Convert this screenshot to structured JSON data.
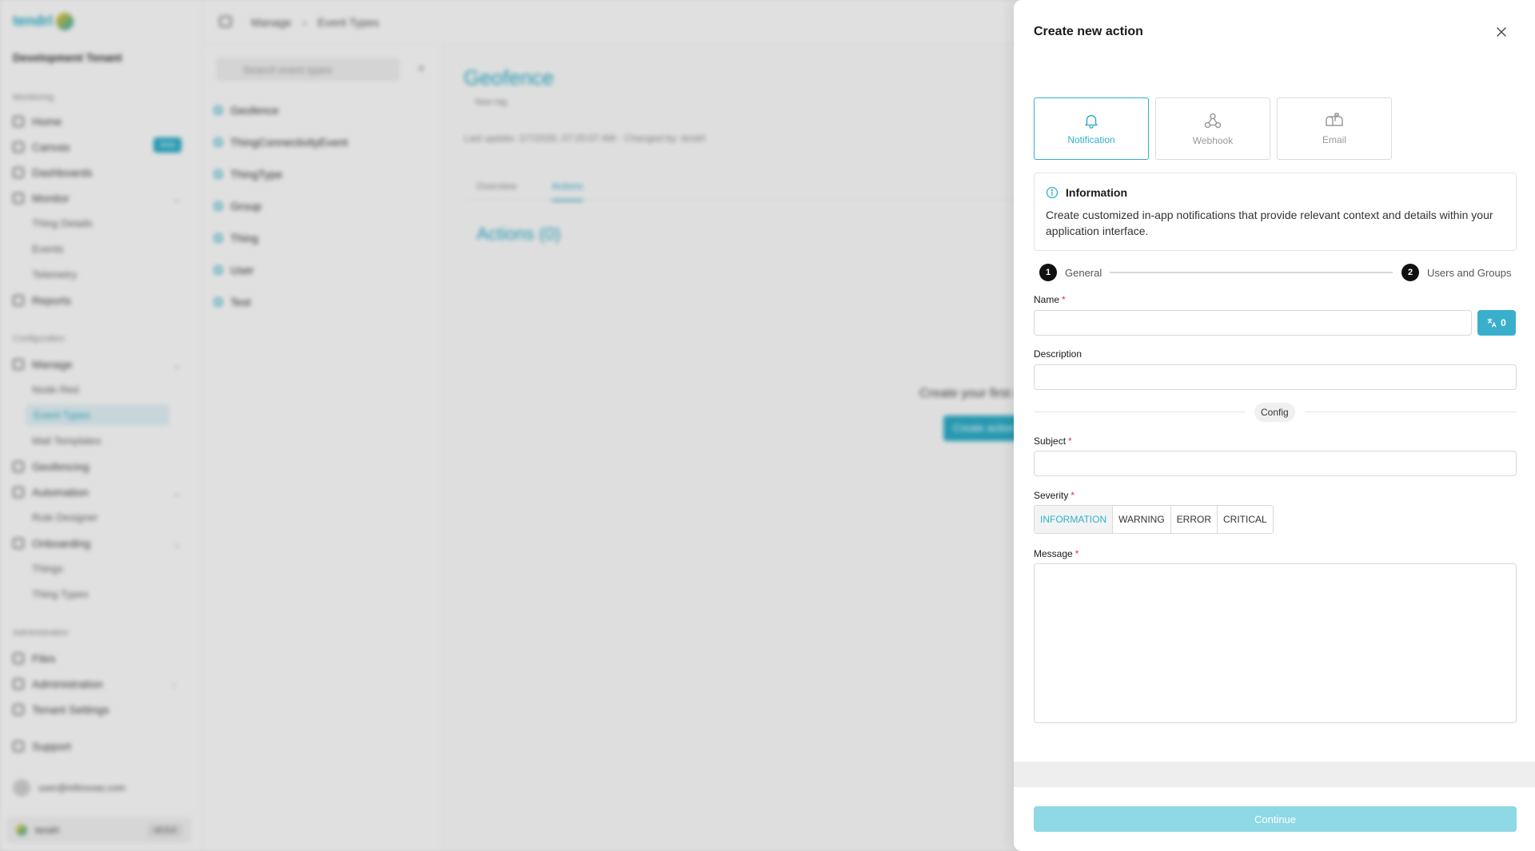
{
  "background": {
    "logo_text": "tendrl",
    "tenant": "Development Tenant",
    "sections": {
      "monitoring": "Monitoring",
      "configuration": "Configuration",
      "administration": "Administration"
    },
    "nav": {
      "home": "Home",
      "canvas": "Canvas",
      "canvas_badge": "beta",
      "dashboards": "Dashboards",
      "monitor": "Monitor",
      "thing_details": "Thing Details",
      "events": "Events",
      "telemetry": "Telemetry",
      "reports": "Reports",
      "manage": "Manage",
      "node_red": "Node Red",
      "event_types": "Event Types",
      "mail_templates": "Mail Templates",
      "geofencing": "Geofencing",
      "automation": "Automation",
      "rule_designer": "Rule Designer",
      "onboarding": "Onboarding",
      "things": "Things",
      "thing_types": "Thing Types",
      "files": "Files",
      "administration": "Administration",
      "tenant_settings": "Tenant Settings",
      "support": "Support"
    },
    "user_email": "user@infinovas.com",
    "footer_brand": "tendrl",
    "footer_version": "v0.0.0",
    "breadcrumb": [
      "Manage",
      "Event Types"
    ],
    "search_placeholder": "Search event types",
    "event_types": [
      "Geofence",
      "ThingConnectivityEvent",
      "ThingType",
      "Group",
      "Thing",
      "User",
      "Test"
    ],
    "title": "Geofence",
    "tag": "New tag",
    "meta": "Last update: 2/7/2026, 07:20:07 AM · Changed by: tendrl",
    "tabs": [
      "Overview",
      "Actions"
    ],
    "actions_heading": "Actions (0)",
    "empty_text": "Create your first action",
    "create_button": "Create action"
  },
  "drawer": {
    "title": "Create new action",
    "types": [
      {
        "label": "Notification",
        "icon": "bell-icon",
        "selected": true
      },
      {
        "label": "Webhook",
        "icon": "webhook-icon",
        "selected": false
      },
      {
        "label": "Email",
        "icon": "mailbox-icon",
        "selected": false
      }
    ],
    "info": {
      "heading": "Information",
      "text": "Create customized in-app notifications that provide relevant context and details within your application interface."
    },
    "steps": [
      {
        "number": "1",
        "label": "General"
      },
      {
        "number": "2",
        "label": "Users and Groups"
      }
    ],
    "fields": {
      "name_label": "Name",
      "name_value": "",
      "translations_count": "0",
      "description_label": "Description",
      "description_value": "",
      "divider_label": "Config",
      "subject_label": "Subject",
      "subject_value": "",
      "severity_label": "Severity",
      "severity_options": [
        "INFORMATION",
        "WARNING",
        "ERROR",
        "CRITICAL"
      ],
      "severity_selected": "INFORMATION",
      "message_label": "Message",
      "message_value": ""
    },
    "required_marker": "*",
    "continue_label": "Continue"
  },
  "colors": {
    "accent": "#32b1c9",
    "continue_disabled": "#8fd8e6",
    "required": "#d9363e"
  }
}
